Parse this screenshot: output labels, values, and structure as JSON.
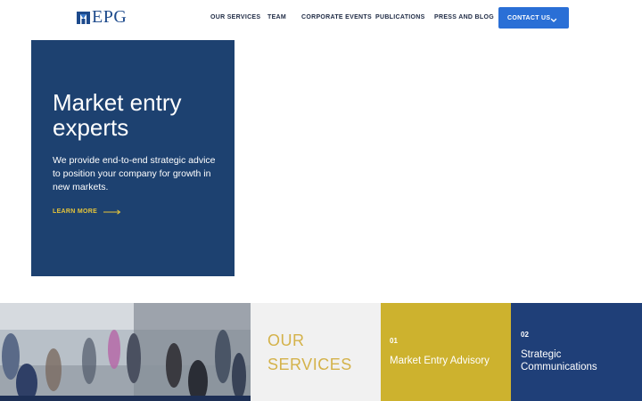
{
  "brand": {
    "logo_text": "EPG",
    "color": "#1d4a8c"
  },
  "nav": {
    "items": [
      {
        "label": "OUR SERVICES"
      },
      {
        "label": "TEAM"
      },
      {
        "label": "CORPORATE EVENTS"
      },
      {
        "label": "PUBLICATIONS"
      },
      {
        "label": "PRESS AND BLOG"
      }
    ],
    "contact_label": "CONTACT US",
    "contact_icon": "chevron-down-icon",
    "accent_color": "#2a6fd6"
  },
  "hero": {
    "title": "Market entry experts",
    "text": "We provide end-to-end strategic advice to position your company for growth in new markets.",
    "cta_label": "LEARN MORE",
    "cta_icon": "arrow-right-icon",
    "card_color": "#1d4170",
    "cta_color": "#e6c53a"
  },
  "services": {
    "heading": "OUR SERVICES",
    "items": [
      {
        "number": "01",
        "name": "Market Entry Advisory",
        "color": "#cdb22e"
      },
      {
        "number": "02",
        "name": "Strategic Communications",
        "color": "#1f3f78"
      }
    ]
  }
}
